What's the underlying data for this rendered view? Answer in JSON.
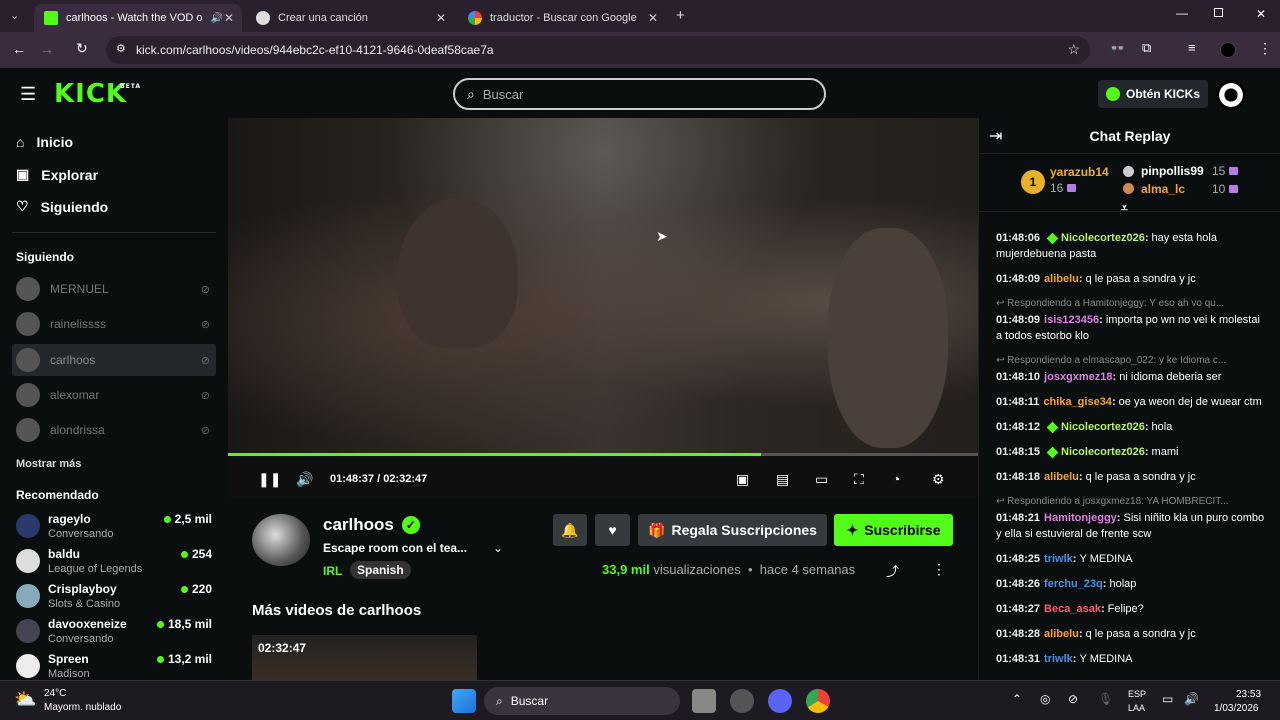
{
  "browser": {
    "tabs": [
      {
        "title": "carlhoos - Watch the VOD o"
      },
      {
        "title": "Crear una canción"
      },
      {
        "title": "traductor - Buscar con Google"
      }
    ],
    "url": "kick.com/carlhoos/videos/944ebc2c-ef10-4121-9646-0deaf58cae7a"
  },
  "header": {
    "logo": "KICK",
    "logo_badge": "BETA",
    "search_placeholder": "Buscar",
    "get_kicks": "Obtén KICKs"
  },
  "sidebar": {
    "nav": [
      {
        "label": "Inicio"
      },
      {
        "label": "Explorar"
      },
      {
        "label": "Siguiendo"
      }
    ],
    "following_title": "Siguiendo",
    "following": [
      {
        "name": "MERNUEL"
      },
      {
        "name": "rainelissss"
      },
      {
        "name": "carlhoos"
      },
      {
        "name": "alexomar"
      },
      {
        "name": "alondrissa"
      }
    ],
    "show_more": "Mostrar más",
    "recommended_title": "Recomendado",
    "recommended": [
      {
        "name": "rageylo",
        "category": "Conversando",
        "viewers": "2,5 mil"
      },
      {
        "name": "baldu",
        "category": "League of Legends",
        "viewers": "254"
      },
      {
        "name": "Crisplayboy",
        "category": "Slots & Casino",
        "viewers": "220"
      },
      {
        "name": "davooxeneize",
        "category": "Conversando",
        "viewers": "18,5 mil"
      },
      {
        "name": "Spreen",
        "category": "Madison",
        "viewers": "13,2 mil"
      }
    ]
  },
  "player": {
    "time": "01:48:37 / 02:32:47",
    "progress": 0.71
  },
  "channel": {
    "name": "carlhoos",
    "title": "Escape room con el tea...",
    "category": "IRL",
    "tag": "Spanish",
    "gift_label": "Regala Suscripciones",
    "subscribe_label": "Suscribirse",
    "views": "33,9 mil",
    "views_suffix": "visualizaciones",
    "ago": "hace 4 semanas",
    "more_videos_title": "Más videos de carlhoos",
    "thumb_duration": "02:32:47"
  },
  "chat": {
    "title": "Chat Replay",
    "leaderboard": [
      {
        "rank": "1",
        "name": "yarazub14",
        "count": "16"
      },
      {
        "name": "pinpollis99",
        "count": "15"
      },
      {
        "name": "alma_lc",
        "count": "10"
      }
    ],
    "messages": [
      {
        "time": "01:48:06",
        "user": "Nicolecortez026",
        "color": "#b8f26a",
        "badge": true,
        "text": "hay esta hola mujerdebuena pasta"
      },
      {
        "time": "01:48:09",
        "user": "alibelu",
        "color": "#f5a623",
        "text": "q le pasa a sondra y jc"
      },
      {
        "reply": "Respondiendo a Hamitonjeggy: Y eso ah vo qu...",
        "time": "01:48:09",
        "user": "isis123456",
        "color": "#e07ee0",
        "text": "importa po wn no vei k molestai a todos estorbo klo"
      },
      {
        "reply": "Respondiendo a elmascapo_022: y ke Idioma c...",
        "time": "01:48:10",
        "user": "josxgxmez18",
        "color": "#e07ee0",
        "text": "ni idioma deberia ser"
      },
      {
        "time": "01:48:11",
        "user": "chika_gise34",
        "color": "#f5a623",
        "text": "oe ya weon dej de wuear ctm"
      },
      {
        "time": "01:48:12",
        "user": "Nicolecortez026",
        "color": "#b8f26a",
        "badge": true,
        "text": "hola"
      },
      {
        "time": "01:48:15",
        "user": "Nicolecortez026",
        "color": "#b8f26a",
        "badge": true,
        "text": "mami"
      },
      {
        "time": "01:48:18",
        "user": "alibelu",
        "color": "#f5a623",
        "text": "q le pasa a sondra y jc"
      },
      {
        "reply": "Respondiendo a josxgxmez18: YA HOMBRECIT...",
        "time": "01:48:21",
        "user": "Hamitonjeggy",
        "color": "#e07ee0",
        "text": "Sisi niñito kla un puro combo y ella si estuvieral de frente scw"
      },
      {
        "time": "01:48:25",
        "user": "triwlk",
        "color": "#4a90e2",
        "text": "Y MEDINA"
      },
      {
        "time": "01:48:26",
        "user": "ferchu_23q",
        "color": "#4a90e2",
        "text": "holap"
      },
      {
        "time": "01:48:27",
        "user": "Beca_asak",
        "color": "#ff5a6e",
        "text": "Felipe?"
      },
      {
        "time": "01:48:28",
        "user": "alibelu",
        "color": "#f5a623",
        "text": "q le pasa a sondra y jc"
      },
      {
        "time": "01:48:31",
        "user": "triwlk",
        "color": "#4a90e2",
        "text": "Y MEDINA"
      }
    ]
  },
  "taskbar": {
    "weather_temp": "24°C",
    "weather_desc": "Mayorm. nublado",
    "search": "Buscar",
    "lang": "ESP",
    "lang2": "LAA",
    "time": "23:53",
    "date": "1/03/2026"
  }
}
